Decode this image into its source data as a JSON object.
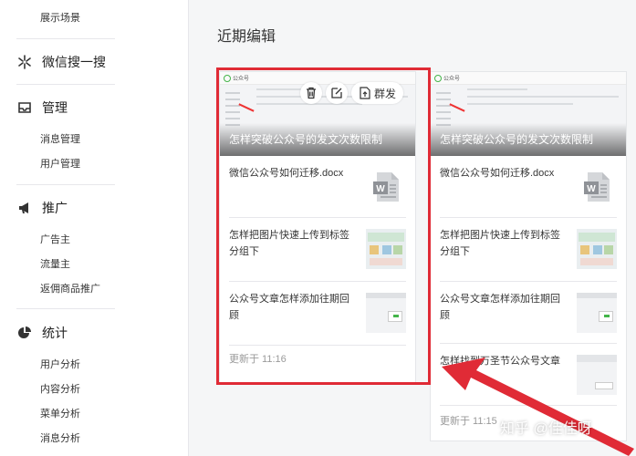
{
  "sidebar": {
    "top_sub_item": "展示场景",
    "sections": [
      {
        "title": "微信搜一搜",
        "icon": "sparkle-icon",
        "items": []
      },
      {
        "title": "管理",
        "icon": "inbox-icon",
        "items": [
          "消息管理",
          "用户管理"
        ]
      },
      {
        "title": "推广",
        "icon": "megaphone-icon",
        "items": [
          "广告主",
          "流量主",
          "返佣商品推广"
        ]
      },
      {
        "title": "统计",
        "icon": "pie-chart-icon",
        "items": [
          "用户分析",
          "内容分析",
          "菜单分析",
          "消息分析"
        ]
      }
    ]
  },
  "main": {
    "title": "近期编辑",
    "cards": [
      {
        "cover_title": "怎样突破公众号的发文次数限制",
        "mini_app_name": "公众号",
        "tools": {
          "delete": "trash-icon",
          "edit": "edit-icon",
          "mass_send_label": "群发"
        },
        "items": [
          {
            "text": "微信公众号如何迁移.docx",
            "thumb": "word-file-icon"
          },
          {
            "text": "怎样把图片快速上传到标签分组下",
            "thumb": "image"
          },
          {
            "text": "公众号文章怎样添加往期回顾",
            "thumb": "image"
          }
        ],
        "updated": "更新于 11:16"
      },
      {
        "cover_title": "怎样突破公众号的发文次数限制",
        "mini_app_name": "公众号",
        "items": [
          {
            "text": "微信公众号如何迁移.docx",
            "thumb": "word-file-icon"
          },
          {
            "text": "怎样把图片快速上传到标签分组下",
            "thumb": "image"
          },
          {
            "text": "公众号文章怎样添加往期回顾",
            "thumb": "image"
          },
          {
            "text": "怎样找到万圣节公众号文章",
            "thumb": "image"
          }
        ],
        "updated": "更新于 11:15"
      }
    ]
  },
  "annotation": {
    "highlight_color": "#e02b36"
  },
  "watermark": "知乎 @佳佳呀"
}
